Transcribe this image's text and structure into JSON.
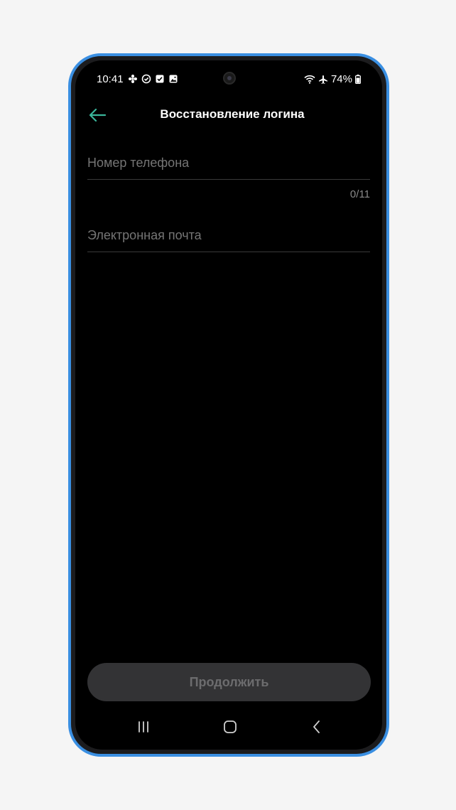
{
  "status_bar": {
    "time": "10:41",
    "battery": "74%"
  },
  "app_bar": {
    "title": "Восстановление логина"
  },
  "form": {
    "phone_placeholder": "Номер телефона",
    "phone_counter": "0/11",
    "email_placeholder": "Электронная почта"
  },
  "actions": {
    "continue_label": "Продолжить"
  },
  "colors": {
    "accent": "#3ab59a",
    "frame": "#3a8fe2",
    "button_bg": "#333335",
    "button_text": "#6c6c6e"
  }
}
